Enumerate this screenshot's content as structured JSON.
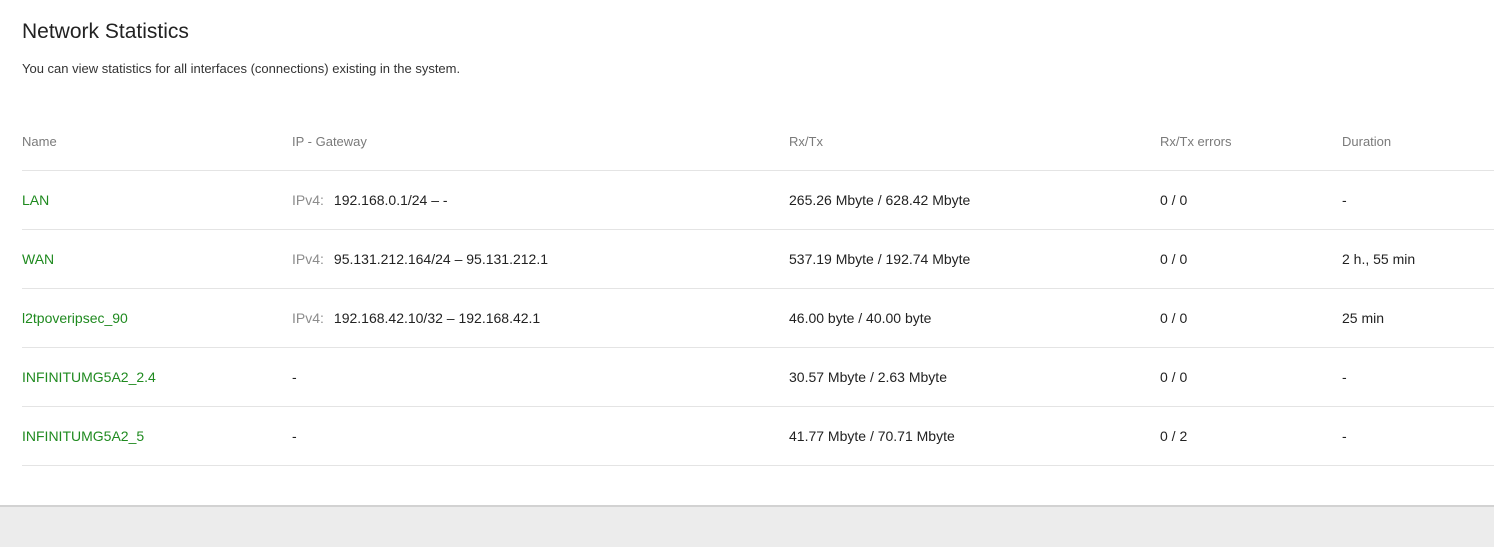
{
  "page": {
    "title": "Network Statistics",
    "description": "You can view statistics for all interfaces (connections) existing in the system."
  },
  "table": {
    "headers": {
      "name": "Name",
      "ip": "IP - Gateway",
      "rxtx": "Rx/Tx",
      "errors": "Rx/Tx errors",
      "duration": "Duration"
    },
    "rows": [
      {
        "name": "LAN",
        "ip_proto": "IPv4:",
        "ip": "192.168.0.1/24 – -",
        "rxtx": "265.26 Mbyte / 628.42 Mbyte",
        "errors": "0 / 0",
        "duration": "-"
      },
      {
        "name": "WAN",
        "ip_proto": "IPv4:",
        "ip": "95.131.212.164/24 – 95.131.212.1",
        "rxtx": "537.19 Mbyte / 192.74 Mbyte",
        "errors": "0 / 0",
        "duration": "2 h., 55 min"
      },
      {
        "name": "l2tpoveripsec_90",
        "ip_proto": "IPv4:",
        "ip": "192.168.42.10/32 – 192.168.42.1",
        "rxtx": "46.00 byte / 40.00 byte",
        "errors": "0 / 0",
        "duration": "25 min"
      },
      {
        "name": "INFINITUMG5A2_2.4",
        "ip_proto": "",
        "ip": "-",
        "rxtx": "30.57 Mbyte / 2.63 Mbyte",
        "errors": "0 / 0",
        "duration": "-"
      },
      {
        "name": "INFINITUMG5A2_5",
        "ip_proto": "",
        "ip": "-",
        "rxtx": "41.77 Mbyte / 70.71 Mbyte",
        "errors": "0 / 2",
        "duration": "-"
      }
    ]
  },
  "colors": {
    "link": "#1f8a1f",
    "header_text": "#7a7a7a",
    "divider": "#e4e4e4",
    "page_background": "#ececec"
  }
}
